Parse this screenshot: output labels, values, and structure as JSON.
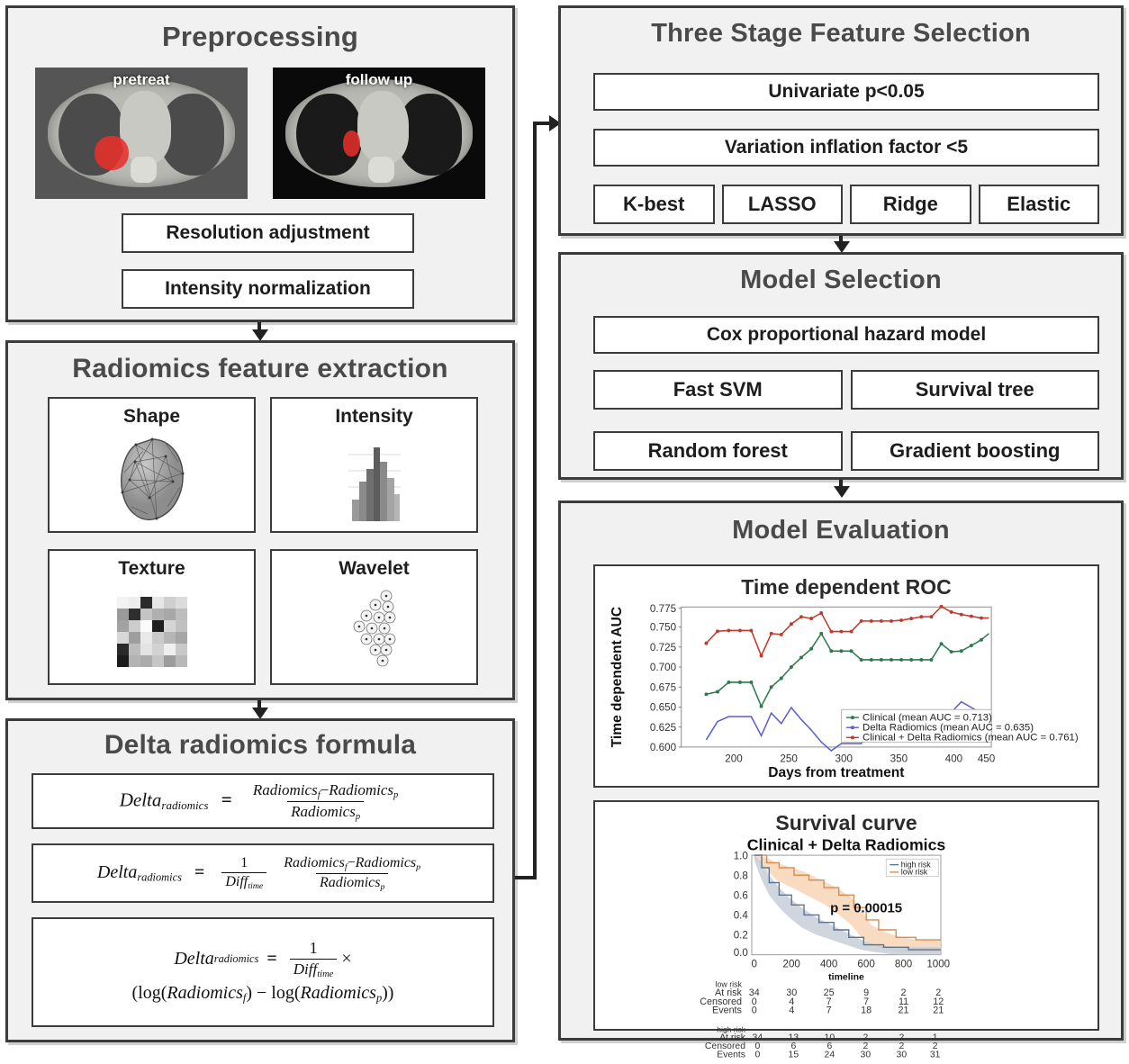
{
  "preprocessing": {
    "title": "Preprocessing",
    "images": [
      {
        "label": "pretreat",
        "name": "ct-pretreat"
      },
      {
        "label": "follow up",
        "name": "ct-followup"
      }
    ],
    "steps": [
      "Resolution adjustment",
      "Intensity normalization"
    ]
  },
  "radiomics": {
    "title": "Radiomics feature extraction",
    "features": [
      {
        "label": "Shape",
        "icon": "mesh-blob-icon"
      },
      {
        "label": "Intensity",
        "icon": "histogram-icon"
      },
      {
        "label": "Texture",
        "icon": "texture-matrix-icon"
      },
      {
        "label": "Wavelet",
        "icon": "wavelet-tree-icon"
      }
    ]
  },
  "delta": {
    "title": "Delta radiomics formula",
    "formulas": [
      {
        "lhs": "Delta",
        "lhs_sub": "radiomics",
        "num": "Radiomics_f − Radiomics_p",
        "den": "Radiomics_p"
      },
      {
        "lhs": "Delta",
        "lhs_sub": "radiomics",
        "coef_num": "1",
        "coef_den": "Diff_time",
        "num": "Radiomics_f − Radiomics_p",
        "den": "Radiomics_p"
      },
      {
        "lhs": "Delta",
        "lhs_sub": "radiomics",
        "coef_num": "1",
        "coef_den": "Diff_time",
        "tail": "(log(Radiomics_f) − log(Radiomics_p))"
      }
    ],
    "terms": {
      "delta": "Delta",
      "radiomics_sub": "radiomics",
      "radiomics": "Radiomics",
      "diff": "Diff",
      "time": "time",
      "f": "f",
      "p": "p",
      "log": "log",
      "equals": "=",
      "minus": "−",
      "times": "×"
    }
  },
  "feature_selection": {
    "title": "Three Stage Feature Selection",
    "stage1": "Univariate p<0.05",
    "stage2": "Variation inflation factor <5",
    "stage3": [
      "K-best",
      "LASSO",
      "Ridge",
      "Elastic"
    ]
  },
  "model_selection": {
    "title": "Model Selection",
    "primary": "Cox proportional hazard model",
    "models": [
      "Fast SVM",
      "Survival tree",
      "Random forest",
      "Gradient boosting"
    ]
  },
  "model_evaluation": {
    "title": "Model Evaluation",
    "roc_heading": "Time dependent ROC",
    "survival_heading": "Survival curve"
  },
  "colors": {
    "panel_bg": "#f1f1f1",
    "panel_border": "#3c3c3c",
    "title_gray": "#4a4a4a",
    "tumor_red": "#e8302a",
    "roc_clinical": "#2c7a4b",
    "roc_delta": "#5b5bd6",
    "roc_combined": "#c0392b",
    "surv_high": "#6b7f99",
    "surv_low": "#e8a56b"
  },
  "chart_data": [
    {
      "type": "line",
      "name": "time-dependent-roc",
      "title": "Time dependent ROC",
      "xlabel": "Days from treatment",
      "ylabel": "Time dependent AUC",
      "xlim": [
        175,
        455
      ],
      "ylim": [
        0.595,
        0.785
      ],
      "xticks": [
        200,
        250,
        300,
        350,
        400,
        450
      ],
      "yticks": [
        0.6,
        0.625,
        0.65,
        0.675,
        0.7,
        0.725,
        0.75,
        0.775
      ],
      "grid": false,
      "legend_position": "lower right",
      "x": [
        180,
        190,
        200,
        208,
        216,
        224,
        232,
        240,
        248,
        256,
        264,
        272,
        280,
        288,
        296,
        304,
        312,
        320,
        328,
        336,
        344,
        352,
        360,
        368,
        376,
        384,
        392,
        400,
        408,
        416,
        424,
        432,
        440
      ],
      "series": [
        {
          "name": "Clinical (mean AUC = 0.713)",
          "color": "#2c7a4b",
          "values": [
            0.672,
            0.675,
            0.687,
            0.687,
            0.687,
            0.657,
            0.681,
            0.692,
            0.706,
            0.718,
            0.729,
            0.748,
            0.726,
            0.726,
            0.726,
            0.715,
            0.715,
            0.715,
            0.715,
            0.715,
            0.715,
            0.715,
            0.715,
            0.735,
            0.725,
            0.726,
            0.733,
            0.74,
            0.748,
            0.748,
            0.748,
            0.748,
            0.748
          ]
        },
        {
          "name": "Delta Radiomics (mean AUC = 0.635)",
          "color": "#5b5bd6",
          "values": [
            0.615,
            0.638,
            0.644,
            0.644,
            0.644,
            0.62,
            0.648,
            0.635,
            0.655,
            0.64,
            0.627,
            0.612,
            0.601,
            0.61,
            0.61,
            0.61,
            0.633,
            0.633,
            0.633,
            0.633,
            0.633,
            0.633,
            0.647,
            0.648,
            0.649,
            0.662,
            0.655,
            0.648,
            0.645,
            0.644,
            0.644,
            0.644,
            0.644
          ]
        },
        {
          "name": "Clinical + Delta Radiomics (mean AUC = 0.761)",
          "color": "#c0392b",
          "values": [
            0.737,
            0.752,
            0.753,
            0.753,
            0.753,
            0.721,
            0.748,
            0.747,
            0.76,
            0.769,
            0.767,
            0.774,
            0.751,
            0.751,
            0.751,
            0.764,
            0.764,
            0.764,
            0.764,
            0.765,
            0.767,
            0.769,
            0.769,
            0.782,
            0.775,
            0.772,
            0.77,
            0.768,
            0.768,
            0.768,
            0.768,
            0.768,
            0.768
          ]
        }
      ]
    },
    {
      "type": "line",
      "name": "survival-curve",
      "title": "Clinical + Delta Radiomics",
      "xlabel": "timeline",
      "ylabel": "",
      "xlim": [
        0,
        1050
      ],
      "ylim": [
        0,
        1.0
      ],
      "xticks": [
        0,
        200,
        400,
        600,
        800,
        1000
      ],
      "yticks": [
        0.0,
        0.2,
        0.4,
        0.6,
        0.8,
        1.0
      ],
      "annotation": "p = 0.00015",
      "legend_position": "upper right",
      "legend": [
        "high risk",
        "low risk"
      ],
      "series": [
        {
          "name": "high risk",
          "color": "#6b7f99",
          "x": [
            0,
            70,
            110,
            150,
            190,
            230,
            270,
            310,
            350,
            400,
            450,
            500,
            560,
            620,
            680,
            720,
            800,
            900,
            1000
          ],
          "values": [
            1.0,
            0.92,
            0.78,
            0.68,
            0.6,
            0.47,
            0.42,
            0.39,
            0.35,
            0.31,
            0.28,
            0.26,
            0.23,
            0.2,
            0.15,
            0.12,
            0.11,
            0.1,
            0.09
          ]
        },
        {
          "name": "low risk",
          "color": "#e8a56b",
          "x": [
            0,
            70,
            110,
            160,
            220,
            280,
            340,
            400,
            460,
            520,
            570,
            600,
            650,
            700,
            760,
            820,
            880,
            940,
            1000
          ],
          "values": [
            1.0,
            0.97,
            0.93,
            0.88,
            0.85,
            0.8,
            0.76,
            0.72,
            0.66,
            0.58,
            0.46,
            0.38,
            0.34,
            0.31,
            0.25,
            0.22,
            0.2,
            0.19,
            0.19
          ]
        }
      ],
      "risk_table": {
        "groups": [
          {
            "label": "low risk",
            "rows": [
              {
                "name": "At risk",
                "values": [
                  34,
                  30,
                  25,
                  9,
                  2,
                  2
                ]
              },
              {
                "name": "Censored",
                "values": [
                  0,
                  4,
                  7,
                  7,
                  11,
                  12
                ]
              },
              {
                "name": "Events",
                "values": [
                  0,
                  4,
                  7,
                  18,
                  21,
                  21
                ]
              }
            ]
          },
          {
            "label": "high risk",
            "rows": [
              {
                "name": "At risk",
                "values": [
                  34,
                  13,
                  10,
                  2,
                  2,
                  1
                ]
              },
              {
                "name": "Censored",
                "values": [
                  0,
                  6,
                  6,
                  2,
                  2,
                  2
                ]
              },
              {
                "name": "Events",
                "values": [
                  0,
                  15,
                  24,
                  30,
                  30,
                  31
                ]
              }
            ]
          }
        ],
        "times": [
          0,
          200,
          400,
          600,
          800,
          1000
        ]
      }
    }
  ]
}
